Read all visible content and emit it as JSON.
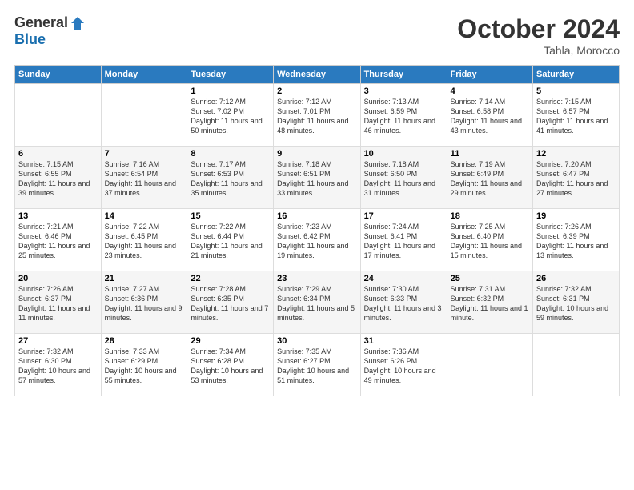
{
  "header": {
    "logo_general": "General",
    "logo_blue": "Blue",
    "month_title": "October 2024",
    "subtitle": "Tahla, Morocco"
  },
  "days_of_week": [
    "Sunday",
    "Monday",
    "Tuesday",
    "Wednesday",
    "Thursday",
    "Friday",
    "Saturday"
  ],
  "weeks": [
    [
      {
        "day": "",
        "info": ""
      },
      {
        "day": "",
        "info": ""
      },
      {
        "day": "1",
        "info": "Sunrise: 7:12 AM\nSunset: 7:02 PM\nDaylight: 11 hours and 50 minutes."
      },
      {
        "day": "2",
        "info": "Sunrise: 7:12 AM\nSunset: 7:01 PM\nDaylight: 11 hours and 48 minutes."
      },
      {
        "day": "3",
        "info": "Sunrise: 7:13 AM\nSunset: 6:59 PM\nDaylight: 11 hours and 46 minutes."
      },
      {
        "day": "4",
        "info": "Sunrise: 7:14 AM\nSunset: 6:58 PM\nDaylight: 11 hours and 43 minutes."
      },
      {
        "day": "5",
        "info": "Sunrise: 7:15 AM\nSunset: 6:57 PM\nDaylight: 11 hours and 41 minutes."
      }
    ],
    [
      {
        "day": "6",
        "info": "Sunrise: 7:15 AM\nSunset: 6:55 PM\nDaylight: 11 hours and 39 minutes."
      },
      {
        "day": "7",
        "info": "Sunrise: 7:16 AM\nSunset: 6:54 PM\nDaylight: 11 hours and 37 minutes."
      },
      {
        "day": "8",
        "info": "Sunrise: 7:17 AM\nSunset: 6:53 PM\nDaylight: 11 hours and 35 minutes."
      },
      {
        "day": "9",
        "info": "Sunrise: 7:18 AM\nSunset: 6:51 PM\nDaylight: 11 hours and 33 minutes."
      },
      {
        "day": "10",
        "info": "Sunrise: 7:18 AM\nSunset: 6:50 PM\nDaylight: 11 hours and 31 minutes."
      },
      {
        "day": "11",
        "info": "Sunrise: 7:19 AM\nSunset: 6:49 PM\nDaylight: 11 hours and 29 minutes."
      },
      {
        "day": "12",
        "info": "Sunrise: 7:20 AM\nSunset: 6:47 PM\nDaylight: 11 hours and 27 minutes."
      }
    ],
    [
      {
        "day": "13",
        "info": "Sunrise: 7:21 AM\nSunset: 6:46 PM\nDaylight: 11 hours and 25 minutes."
      },
      {
        "day": "14",
        "info": "Sunrise: 7:22 AM\nSunset: 6:45 PM\nDaylight: 11 hours and 23 minutes."
      },
      {
        "day": "15",
        "info": "Sunrise: 7:22 AM\nSunset: 6:44 PM\nDaylight: 11 hours and 21 minutes."
      },
      {
        "day": "16",
        "info": "Sunrise: 7:23 AM\nSunset: 6:42 PM\nDaylight: 11 hours and 19 minutes."
      },
      {
        "day": "17",
        "info": "Sunrise: 7:24 AM\nSunset: 6:41 PM\nDaylight: 11 hours and 17 minutes."
      },
      {
        "day": "18",
        "info": "Sunrise: 7:25 AM\nSunset: 6:40 PM\nDaylight: 11 hours and 15 minutes."
      },
      {
        "day": "19",
        "info": "Sunrise: 7:26 AM\nSunset: 6:39 PM\nDaylight: 11 hours and 13 minutes."
      }
    ],
    [
      {
        "day": "20",
        "info": "Sunrise: 7:26 AM\nSunset: 6:37 PM\nDaylight: 11 hours and 11 minutes."
      },
      {
        "day": "21",
        "info": "Sunrise: 7:27 AM\nSunset: 6:36 PM\nDaylight: 11 hours and 9 minutes."
      },
      {
        "day": "22",
        "info": "Sunrise: 7:28 AM\nSunset: 6:35 PM\nDaylight: 11 hours and 7 minutes."
      },
      {
        "day": "23",
        "info": "Sunrise: 7:29 AM\nSunset: 6:34 PM\nDaylight: 11 hours and 5 minutes."
      },
      {
        "day": "24",
        "info": "Sunrise: 7:30 AM\nSunset: 6:33 PM\nDaylight: 11 hours and 3 minutes."
      },
      {
        "day": "25",
        "info": "Sunrise: 7:31 AM\nSunset: 6:32 PM\nDaylight: 11 hours and 1 minute."
      },
      {
        "day": "26",
        "info": "Sunrise: 7:32 AM\nSunset: 6:31 PM\nDaylight: 10 hours and 59 minutes."
      }
    ],
    [
      {
        "day": "27",
        "info": "Sunrise: 7:32 AM\nSunset: 6:30 PM\nDaylight: 10 hours and 57 minutes."
      },
      {
        "day": "28",
        "info": "Sunrise: 7:33 AM\nSunset: 6:29 PM\nDaylight: 10 hours and 55 minutes."
      },
      {
        "day": "29",
        "info": "Sunrise: 7:34 AM\nSunset: 6:28 PM\nDaylight: 10 hours and 53 minutes."
      },
      {
        "day": "30",
        "info": "Sunrise: 7:35 AM\nSunset: 6:27 PM\nDaylight: 10 hours and 51 minutes."
      },
      {
        "day": "31",
        "info": "Sunrise: 7:36 AM\nSunset: 6:26 PM\nDaylight: 10 hours and 49 minutes."
      },
      {
        "day": "",
        "info": ""
      },
      {
        "day": "",
        "info": ""
      }
    ]
  ]
}
